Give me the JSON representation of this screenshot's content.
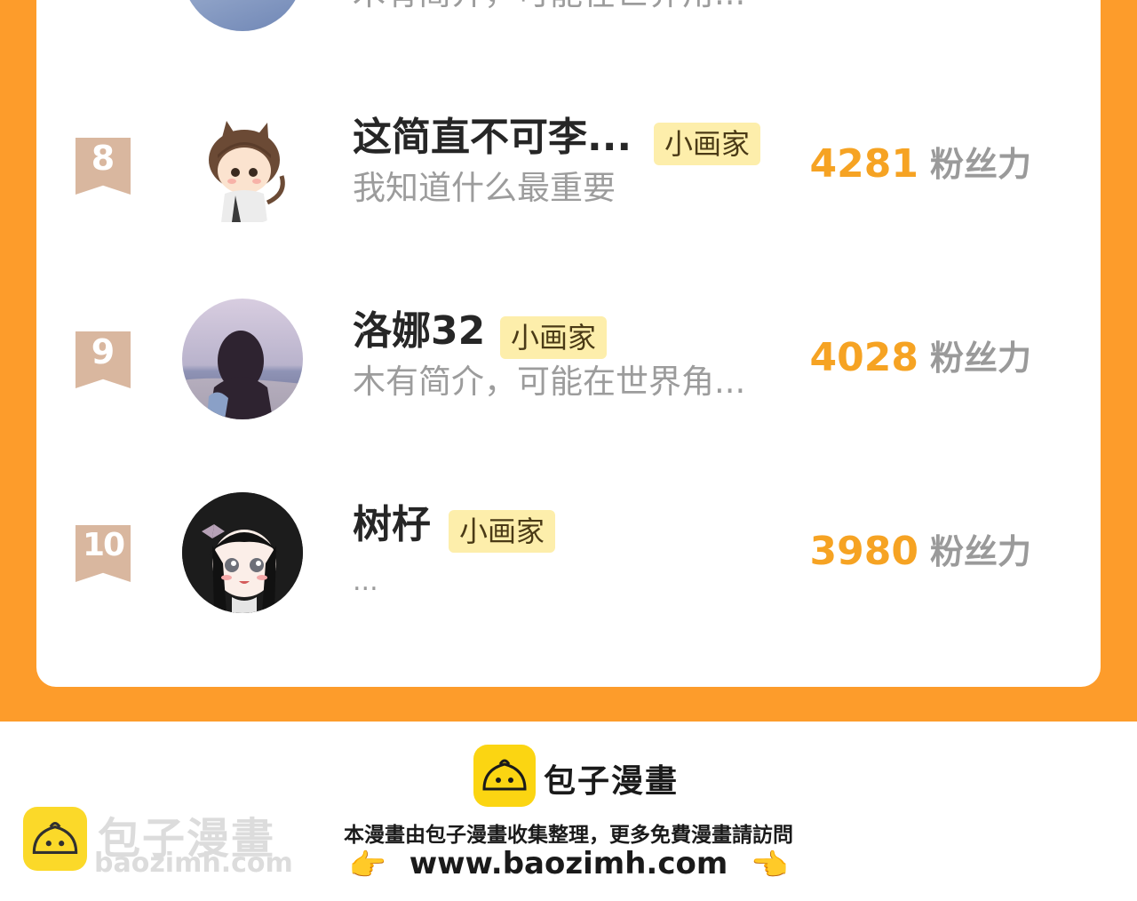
{
  "ranking": {
    "partial_top": {
      "desc": "木有简介，可能在世界角..."
    },
    "rows": [
      {
        "rank": "8",
        "name": "这简直不可李...",
        "badge": "小画家",
        "desc": "我知道什么最重要",
        "score": "4281",
        "unit": "粉丝力",
        "avatar": "chibi-cat-boy-avatar"
      },
      {
        "rank": "9",
        "name": "洛娜32",
        "badge": "小画家",
        "desc": "木有简介，可能在世界角...",
        "score": "4028",
        "unit": "粉丝力",
        "avatar": "girl-at-beach-avatar"
      },
      {
        "rank": "10",
        "name": "树杍",
        "badge": "小画家",
        "desc": "...",
        "score": "3980",
        "unit": "粉丝力",
        "avatar": "anime-girl-bow-avatar"
      }
    ]
  },
  "footer": {
    "brand": "包子漫畫",
    "note": "本漫畫由包子漫畫收集整理，更多免費漫畫請訪問",
    "url": "www.baozimh.com",
    "left_hand": "👉",
    "right_hand": "👈"
  },
  "watermark": {
    "brand": "包子漫畫",
    "url": "baozimh.com"
  },
  "colors": {
    "page_orange": "#fd9c2b",
    "score_orange": "#f6a323",
    "badge_bg": "#fdeeab",
    "rank_ribbon": "#d9b79f",
    "logo_yellow": "#fbd512"
  }
}
